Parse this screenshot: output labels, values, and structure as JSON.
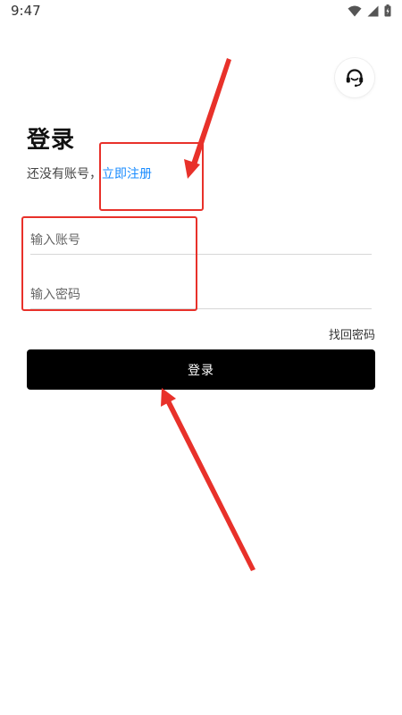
{
  "status_bar": {
    "time": "9:47",
    "icons": [
      "wifi-icon",
      "signal-icon",
      "battery-icon"
    ]
  },
  "support": {
    "icon": "headset-icon"
  },
  "login": {
    "title": "登录",
    "register_prompt": "还没有账号，",
    "register_link": "立即注册",
    "account_placeholder": "输入账号",
    "account_value": "",
    "password_placeholder": "输入密码",
    "password_value": "",
    "forgot_password": "找回密码",
    "submit_label": "登录"
  },
  "colors": {
    "link": "#1a8cff",
    "button_bg": "#000000",
    "button_text": "#ffffff",
    "annotation": "#e8312a"
  }
}
